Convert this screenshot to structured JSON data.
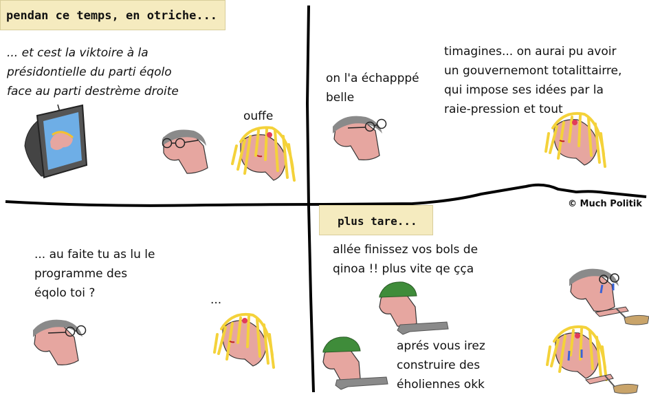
{
  "captions": {
    "panel1": "pendan ce temps, en otriche...",
    "panel4": "plus tare..."
  },
  "panel1": {
    "tv_speech": [
      "...  et cest la viktoire à la",
      "présidontielle du parti éqolo",
      "face au parti destrème droite"
    ],
    "woman_speech": "ouffe"
  },
  "panel2": {
    "man_speech": [
      "on l'a échapppé",
      "belle"
    ],
    "woman_speech": [
      "timagines... on aurai pu avoir",
      "un gouvernemont totalittairre,",
      "qui impose ses idées par la",
      "raie-pression et tout"
    ]
  },
  "panel3": {
    "man_speech": [
      "... au faite tu as lu le",
      "programme des",
      "éqolo toi ?"
    ],
    "woman_speech": "..."
  },
  "panel4": {
    "soldier_speech_1": [
      "allée finissez vos bols de",
      "qinoa !! plus vite qe çça"
    ],
    "soldier_speech_2": [
      "aprés vous irez",
      "construire des",
      "éholiennes okk"
    ]
  },
  "copyright": "© Much Politik",
  "colors": {
    "caption_bg": "#f5ebbf",
    "skin": "#e6a6a0",
    "hair_grey": "#8a8a8a",
    "hair_blonde": "#f4d23a",
    "helmet": "#3f8c3a",
    "tv_screen": "#6eaee6",
    "tear": "#3a63d6"
  }
}
